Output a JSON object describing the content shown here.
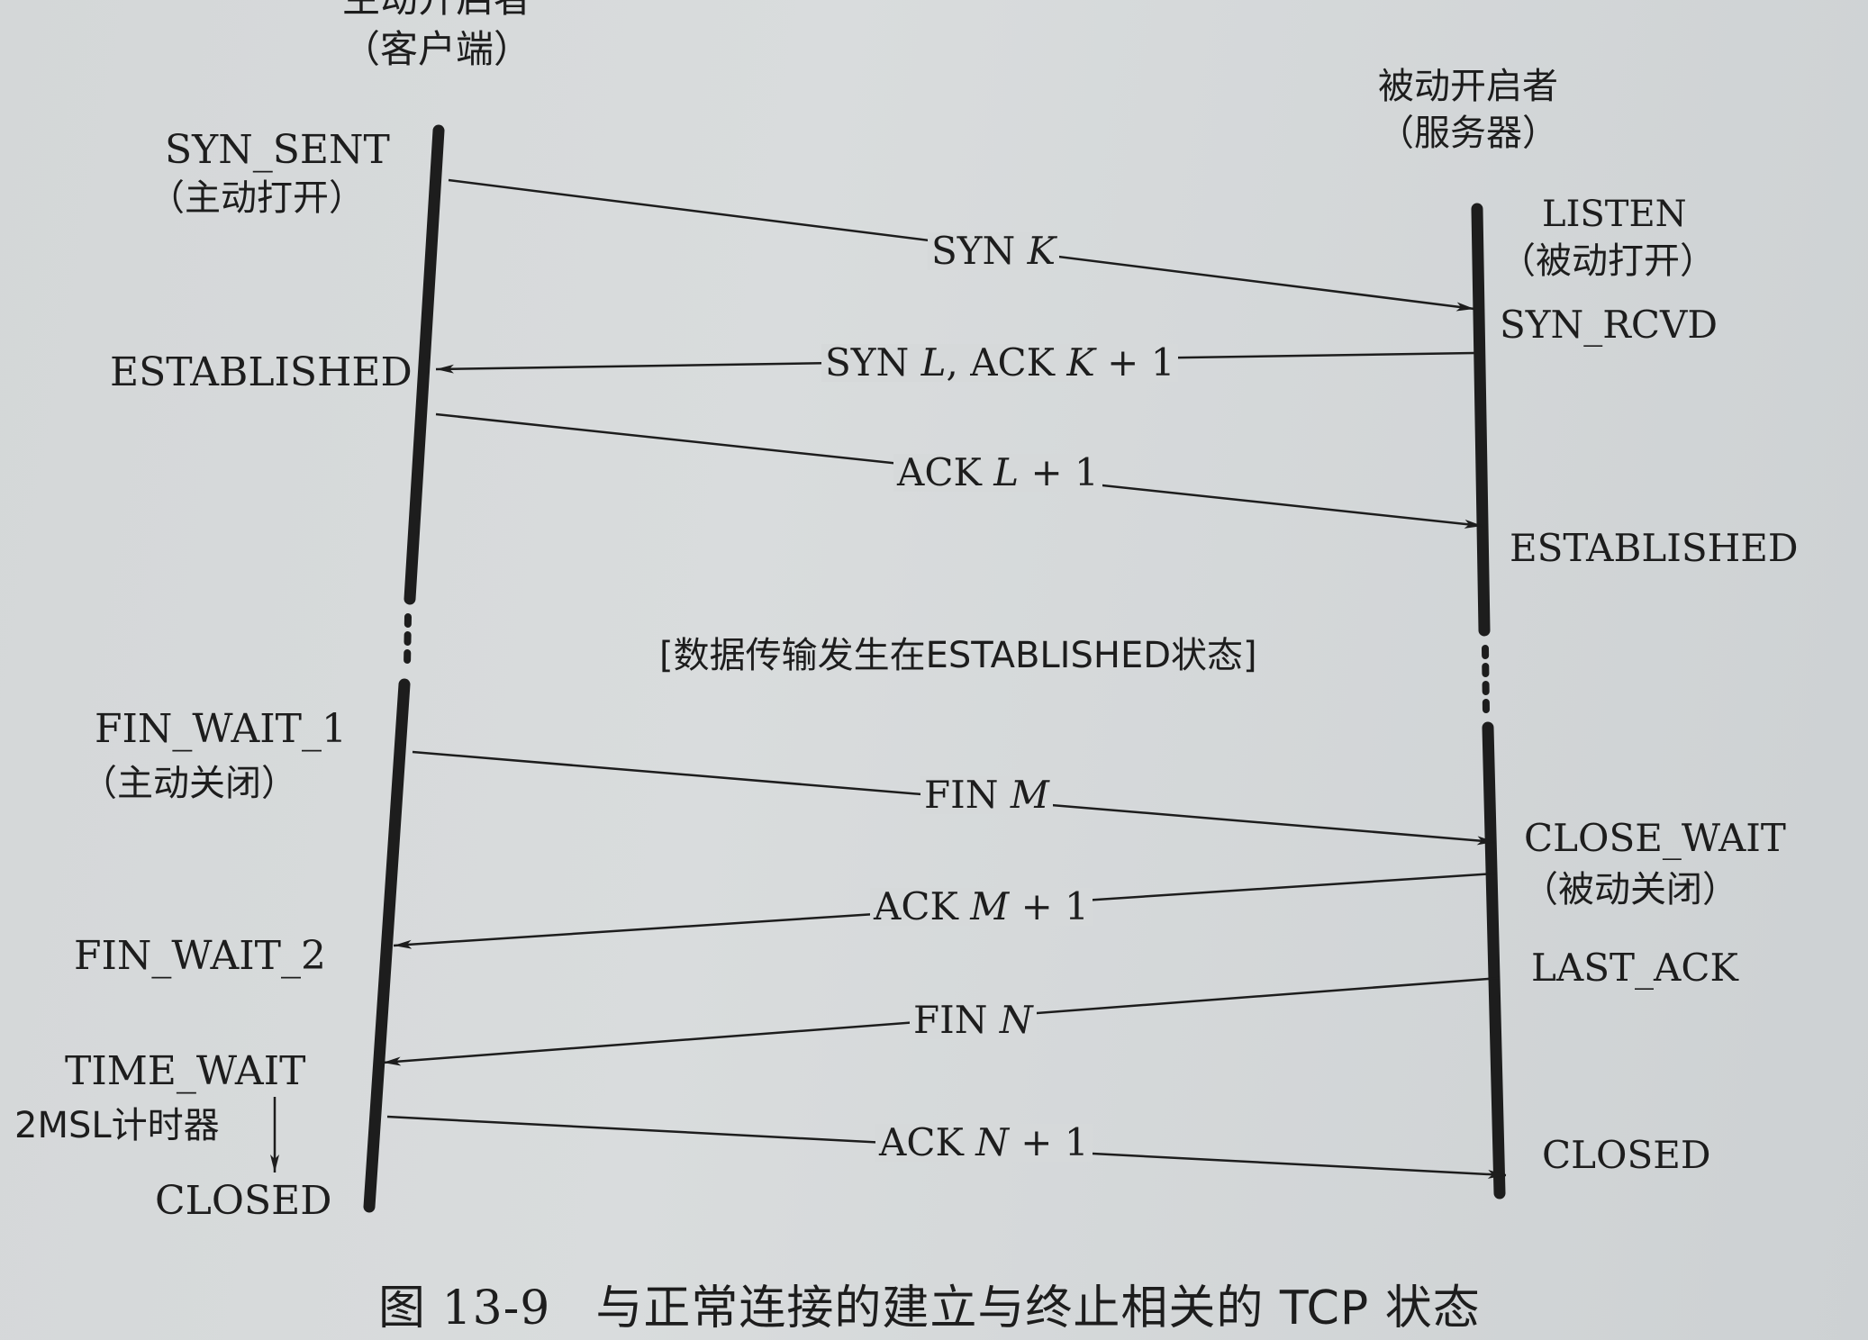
{
  "client": {
    "title_line1": "主动开启者",
    "title_line2": "（客户端）"
  },
  "server": {
    "title_line1": "被动开启者",
    "title_line2": "（服务器）"
  },
  "client_states": {
    "syn_sent": "SYN_SENT",
    "active_open": "（主动打开）",
    "established": "ESTABLISHED",
    "fin_wait_1": "FIN_WAIT_1",
    "active_close": "（主动关闭）",
    "fin_wait_2": "FIN_WAIT_2",
    "time_wait": "TIME_WAIT",
    "timer": "2MSL计时器",
    "closed": "CLOSED"
  },
  "server_states": {
    "listen": "LISTEN",
    "passive_open": "（被动打开）",
    "syn_rcvd": "SYN_RCVD",
    "established": "ESTABLISHED",
    "close_wait": "CLOSE_WAIT",
    "passive_close": "（被动关闭）",
    "last_ack": "LAST_ACK",
    "closed": "CLOSED"
  },
  "messages": {
    "syn_k": {
      "pre": "SYN ",
      "var": "K",
      "post": ""
    },
    "syn_l_ack": {
      "pre": "SYN ",
      "var": "L",
      "mid": ", ACK ",
      "var2": "K",
      "post": " + 1"
    },
    "ack_l": {
      "pre": "ACK ",
      "var": "L",
      "post": " + 1"
    },
    "fin_m": {
      "pre": "FIN ",
      "var": "M",
      "post": ""
    },
    "ack_m": {
      "pre": "ACK ",
      "var": "M",
      "post": " + 1"
    },
    "fin_n": {
      "pre": "FIN ",
      "var": "N",
      "post": ""
    },
    "ack_n": {
      "pre": "ACK ",
      "var": "N",
      "post": " + 1"
    }
  },
  "data_transfer_note": "[数据传输发生在ESTABLISHED状态]",
  "caption": {
    "number": "图 13-9",
    "text": "与正常连接的建立与终止相关的 TCP 状态"
  },
  "colors": {
    "ink": "#1d1d1d",
    "paper": "#d6d9da"
  }
}
